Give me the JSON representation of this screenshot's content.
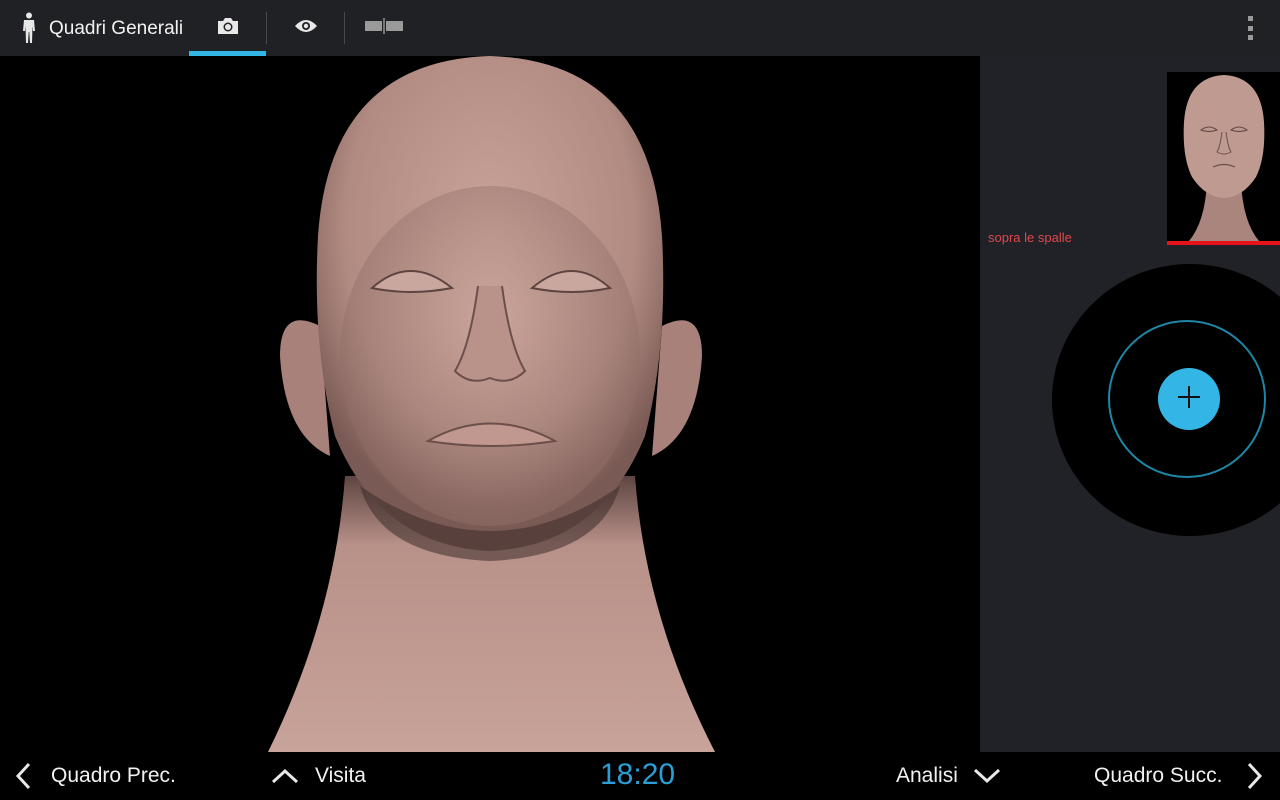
{
  "app": {
    "title": "Quadri Generali",
    "icon": "person-icon"
  },
  "toolbar": {
    "tabs": [
      {
        "icon": "camera-icon",
        "selected": true
      },
      {
        "icon": "eye-icon",
        "selected": false
      },
      {
        "icon": "split-view-icon",
        "selected": false
      }
    ],
    "overflow_icon": "more-vert-icon",
    "accent_color": "#33b5e5"
  },
  "side_panel": {
    "caption": "sopra le spalle",
    "caption_color": "#e0474c",
    "selection_color": "#e8131a",
    "joystick_icon": "plus-icon"
  },
  "bottom_bar": {
    "prev_label": "Quadro Prec.",
    "visita_label": "Visita",
    "clock": "18:20",
    "analisi_label": "Analisi",
    "next_label": "Quadro Succ."
  }
}
